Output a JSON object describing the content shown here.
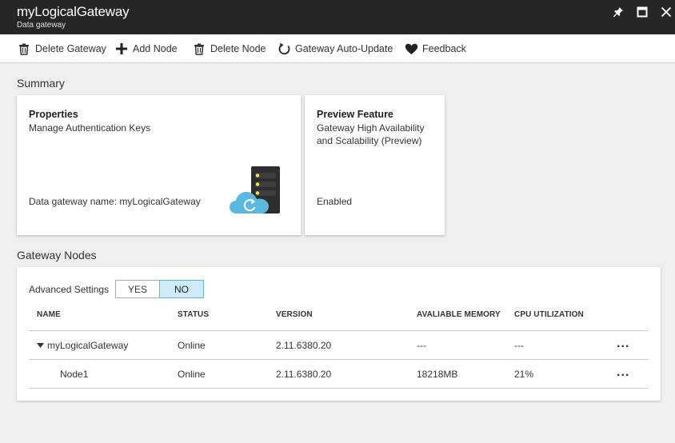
{
  "window": {
    "title": "myLogicalGateway",
    "subtitle": "Data gateway"
  },
  "toolbar": {
    "delete_gateway": "Delete Gateway",
    "add_node": "Add Node",
    "delete_node": "Delete Node",
    "auto_update": "Gateway Auto-Update",
    "feedback": "Feedback"
  },
  "summary": {
    "heading": "Summary",
    "properties": {
      "title": "Properties",
      "subtitle": "Manage Authentication Keys",
      "footer": "Data gateway name: myLogicalGateway"
    },
    "preview": {
      "title": "Preview Feature",
      "subtitle_line1": "Gateway High Availability",
      "subtitle_line2": "and Scalability (Preview)",
      "footer": "Enabled"
    }
  },
  "nodes": {
    "heading": "Gateway Nodes",
    "advanced_label": "Advanced Settings",
    "yes": "YES",
    "no": "NO",
    "selected": "NO",
    "columns": [
      "NAME",
      "STATUS",
      "VERSION",
      "AVALIABLE MEMORY",
      "CPU UTILIZATION"
    ],
    "rows": [
      {
        "name": "myLogicalGateway",
        "status": "Online",
        "version": "2.11.6380.20",
        "memory": "---",
        "cpu": "---",
        "more": "..."
      },
      {
        "name": "Node1",
        "status": "Online",
        "version": "2.11.6380.20",
        "memory": "18218MB",
        "cpu": "21%",
        "more": "..."
      }
    ]
  },
  "colors": {
    "titlebar_bg": "#262626",
    "toggle_selected_bg": "#cfeaf8",
    "toggle_selected_border": "#5fb2d8",
    "cloud": "#5bb8e0",
    "server": "#2d2d2d",
    "server_led": "#f2e94b"
  }
}
